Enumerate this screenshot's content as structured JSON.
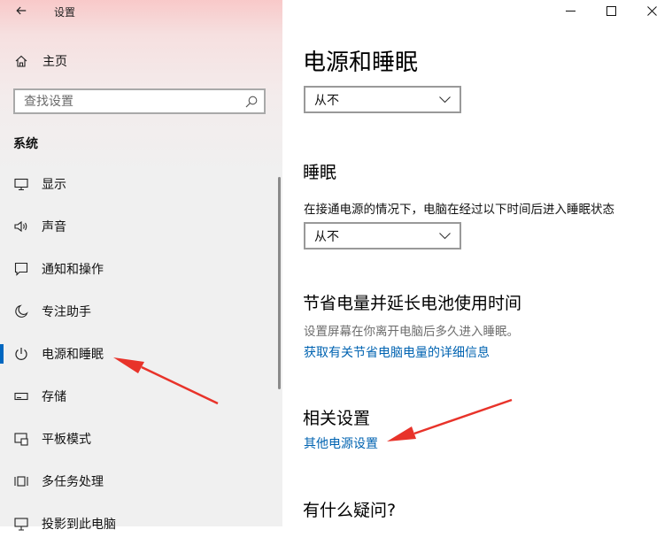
{
  "window": {
    "title": "设置",
    "back_icon": "back-arrow-icon"
  },
  "sidebar": {
    "home_label": "主页",
    "search_placeholder": "查找设置",
    "section_title": "系统",
    "items": [
      {
        "label": "显示",
        "icon": "monitor-icon"
      },
      {
        "label": "声音",
        "icon": "speaker-icon"
      },
      {
        "label": "通知和操作",
        "icon": "notification-icon"
      },
      {
        "label": "专注助手",
        "icon": "moon-icon"
      },
      {
        "label": "电源和睡眠",
        "icon": "power-icon",
        "active": true
      },
      {
        "label": "存储",
        "icon": "storage-icon"
      },
      {
        "label": "平板模式",
        "icon": "tablet-icon"
      },
      {
        "label": "多任务处理",
        "icon": "multitask-icon"
      },
      {
        "label": "投影到此电脑",
        "icon": "project-icon"
      }
    ]
  },
  "main": {
    "title": "电源和睡眠",
    "screen_dropdown_value": "从不",
    "sleep_heading": "睡眠",
    "sleep_description": "在接通电源的情况下，电脑在经过以下时间后进入睡眠状态",
    "sleep_dropdown_value": "从不",
    "save_heading": "节省电量并延长电池使用时间",
    "save_description": "设置屏幕在你离开电脑后多久进入睡眠。",
    "save_link": "获取有关节省电脑电量的详细信息",
    "related_heading": "相关设置",
    "power_link": "其他电源设置",
    "question_heading": "有什么疑问?"
  },
  "colors": {
    "accent": "#0067c0",
    "link": "#0063b1",
    "annotation_arrow": "#e8332a"
  }
}
